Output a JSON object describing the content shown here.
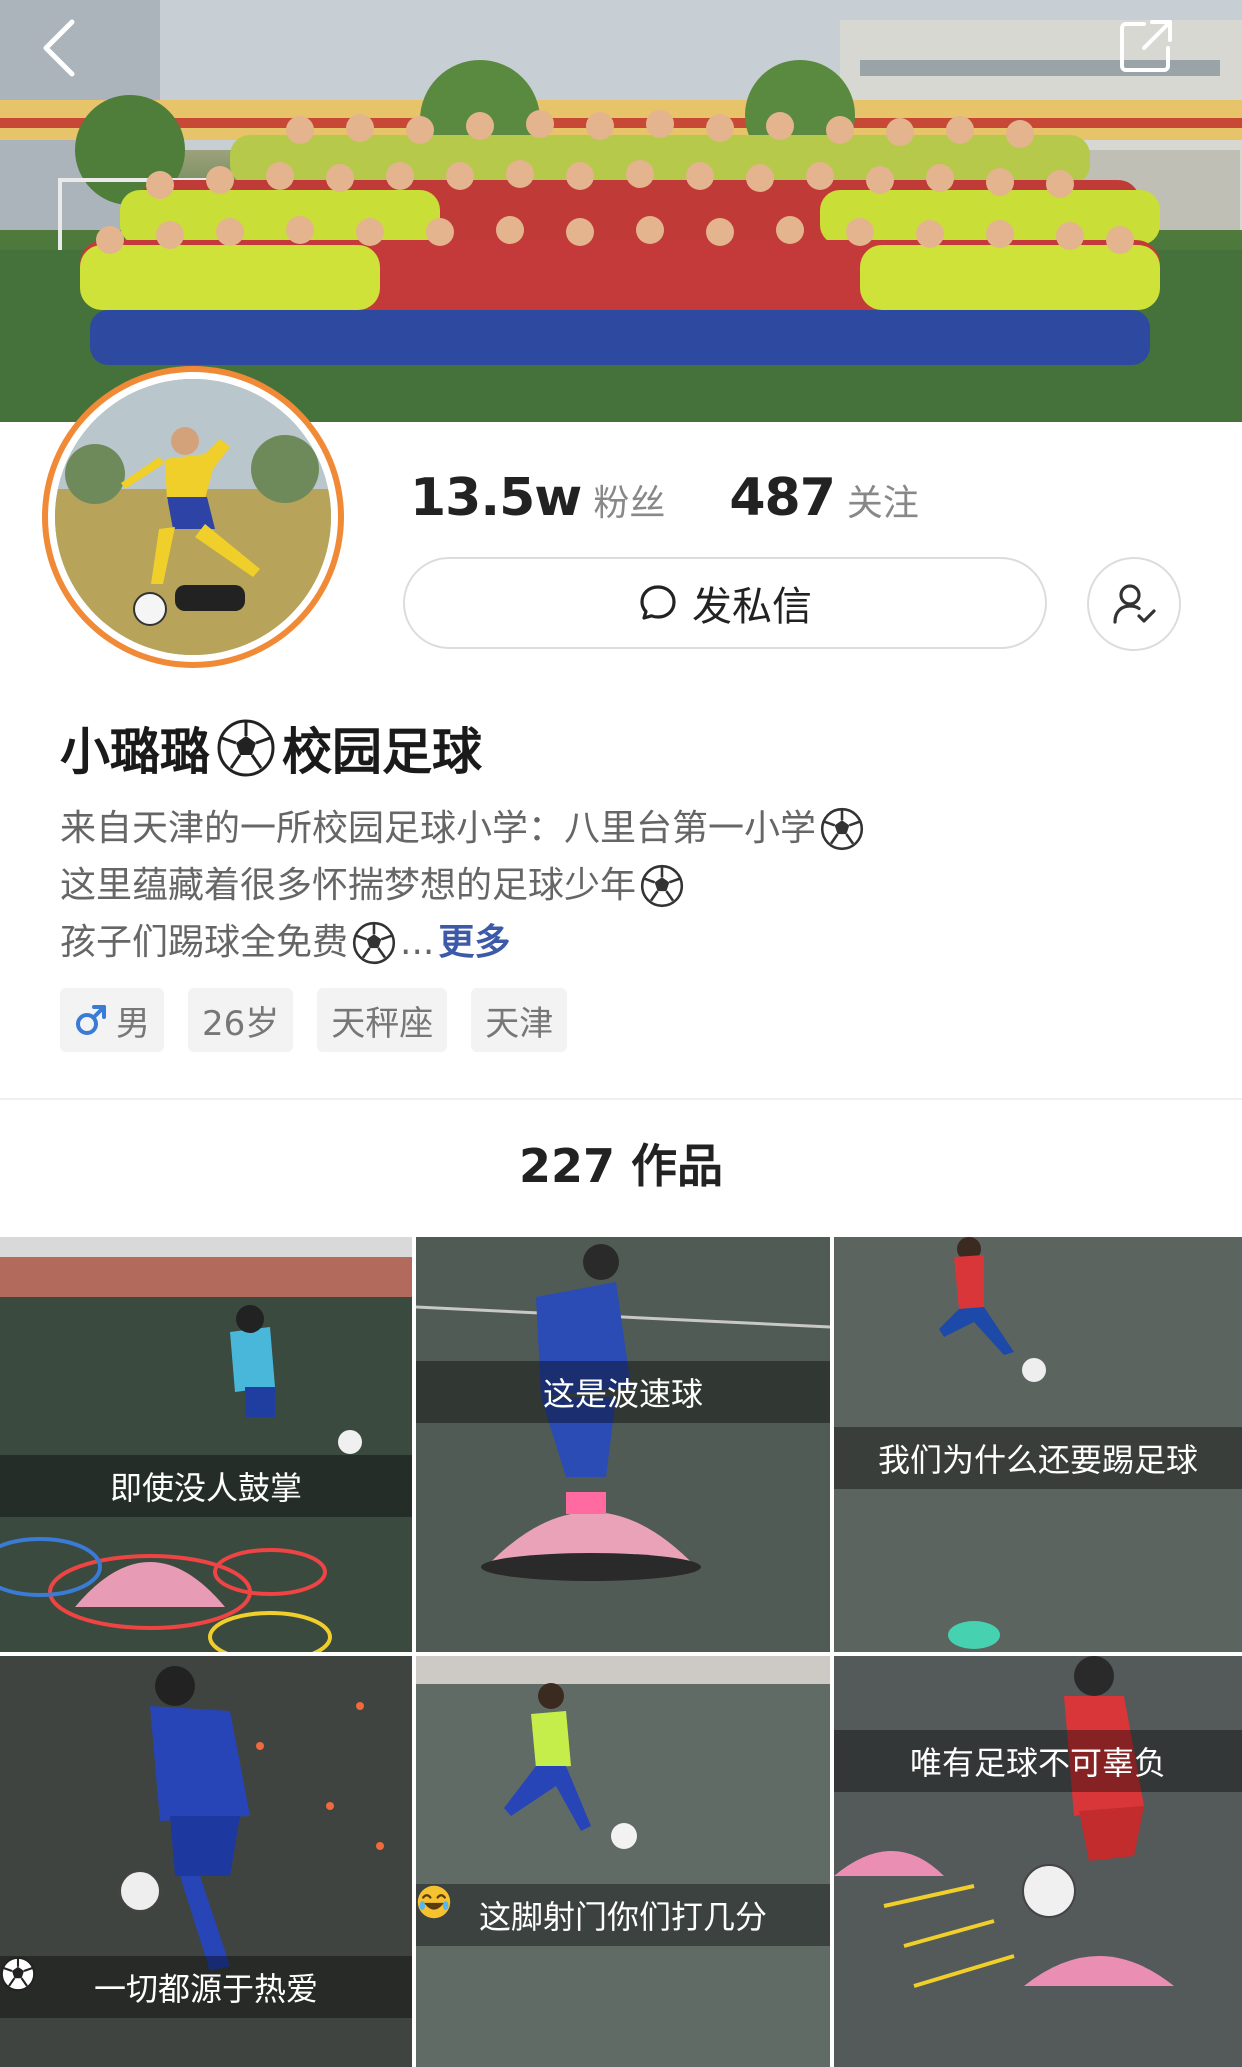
{
  "topbar": {
    "back_icon": "chevron-left-icon",
    "share_icon": "share-icon"
  },
  "profile": {
    "followers_count": "13.5w",
    "followers_label": "粉丝",
    "following_count": "487",
    "following_label": "关注",
    "message_button": "发私信",
    "nickname_part1": "小璐璐",
    "nickname_part2": "校园足球",
    "bio_line1": "来自天津的一所校园足球小学：八里台第一小学",
    "bio_line2": "这里蕴藏着很多怀揣梦想的足球少年",
    "bio_line3": "孩子们踢球全免费",
    "bio_ellipsis": "...",
    "bio_more": "更多",
    "tags": [
      "男",
      "26岁",
      "天秤座",
      "天津"
    ],
    "accent_color": "#f08a36",
    "link_color": "#3d5aa8"
  },
  "works": {
    "count": "227",
    "label": "作品",
    "items": [
      {
        "caption": "即使没人鼓掌"
      },
      {
        "caption": "这是波速球"
      },
      {
        "caption": "我们为什么还要踢足球"
      },
      {
        "caption": "一切都源于热爱"
      },
      {
        "caption": "这脚射门你们打几分"
      },
      {
        "caption": "唯有足球不可辜负"
      }
    ]
  }
}
